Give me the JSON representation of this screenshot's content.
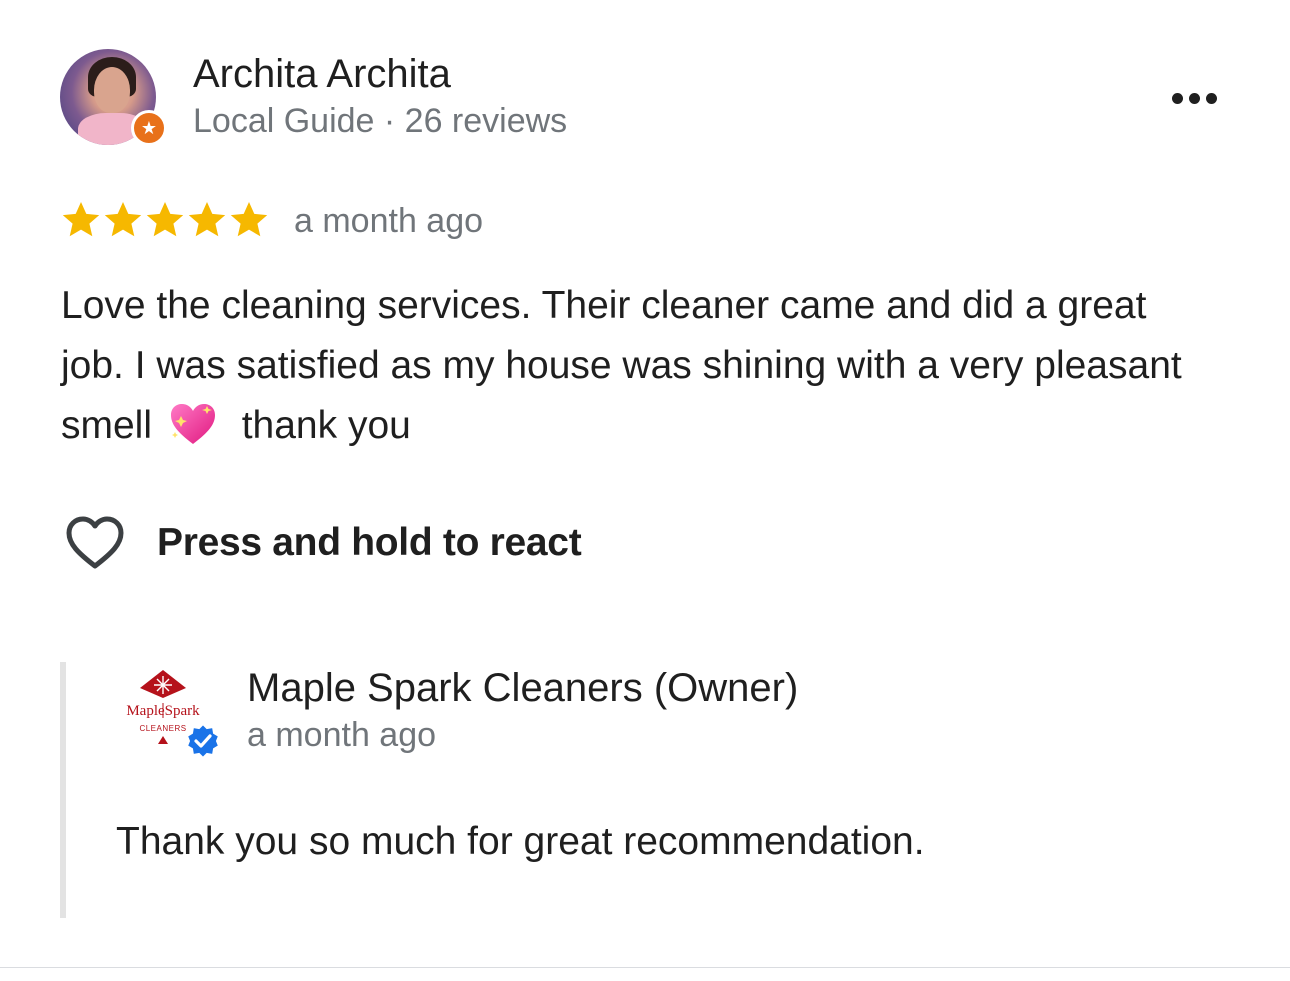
{
  "reviewer": {
    "name": "Archita Archita",
    "meta": "Local Guide · 26 reviews",
    "badge_icon": "star-icon"
  },
  "review": {
    "rating": 5,
    "rating_max": 5,
    "date": "a month ago",
    "text_part1": "Love the cleaning services. Their cleaner came and did a great job. I was satisfied as my house was shining with a very pleasant smell",
    "emoji": "sparkling-heart-icon",
    "text_part2": "thank you"
  },
  "react": {
    "label": "Press and hold to react",
    "icon": "heart-outline-icon"
  },
  "owner_reply": {
    "name": "Maple Spark Cleaners (Owner)",
    "date": "a month ago",
    "text": "Thank you so much for great recommendation.",
    "logo_text": "MapleSpark",
    "logo_subtext": "CLEANERS",
    "verified_icon": "verified-check-icon"
  },
  "colors": {
    "star": "#F6B800",
    "guide_badge": "#E8711A",
    "verified": "#1A73E8",
    "logo_red": "#B5121B",
    "secondary_text": "#70757A"
  }
}
